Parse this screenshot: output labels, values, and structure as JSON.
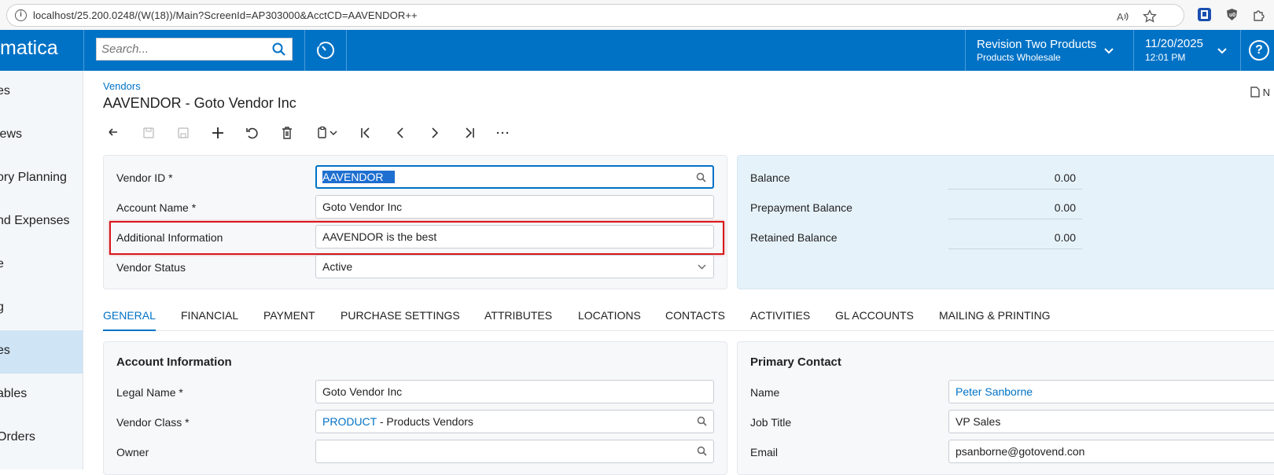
{
  "browser": {
    "url": "localhost/25.200.0248/(W(18))/Main?ScreenId=AP303000&AcctCD=AAVENDOR++"
  },
  "header": {
    "logo": "matica",
    "search_placeholder": "Search...",
    "company_title": "Revision Two Products",
    "company_sub": "Products Wholesale",
    "date": "11/20/2025",
    "time": "12:01 PM",
    "help": "?"
  },
  "sidebar": {
    "items": [
      {
        "label": "es"
      },
      {
        "label": "iews"
      },
      {
        "label": "ory Planning"
      },
      {
        "label": "nd Expenses"
      },
      {
        "label": "e"
      },
      {
        "label": "g"
      },
      {
        "label": "es"
      },
      {
        "label": "ables"
      },
      {
        "label": "Orders"
      }
    ]
  },
  "page": {
    "breadcrumb": "Vendors",
    "title": "AAVENDOR - Goto Vendor Inc",
    "notes": "N"
  },
  "summary": {
    "vendor_id_label": "Vendor ID *",
    "vendor_id_value": "AAVENDOR",
    "account_name_label": "Account Name *",
    "account_name_value": "Goto Vendor Inc",
    "additional_info_label": "Additional Information",
    "additional_info_value": "AAVENDOR is the best",
    "vendor_status_label": "Vendor Status",
    "vendor_status_value": "Active"
  },
  "balances": {
    "balance_label": "Balance",
    "balance_value": "0.00",
    "prepayment_label": "Prepayment Balance",
    "prepayment_value": "0.00",
    "retained_label": "Retained Balance",
    "retained_value": "0.00"
  },
  "tabs": [
    "GENERAL",
    "FINANCIAL",
    "PAYMENT",
    "PURCHASE SETTINGS",
    "ATTRIBUTES",
    "LOCATIONS",
    "CONTACTS",
    "ACTIVITIES",
    "GL ACCOUNTS",
    "MAILING & PRINTING"
  ],
  "account_info": {
    "title": "Account Information",
    "legal_name_label": "Legal Name *",
    "legal_name_value": "Goto Vendor Inc",
    "vendor_class_label": "Vendor Class *",
    "vendor_class_code": "PRODUCT",
    "vendor_class_desc": " - Products Vendors",
    "owner_label": "Owner",
    "owner_value": ""
  },
  "primary_contact": {
    "title": "Primary Contact",
    "name_label": "Name",
    "name_value": "Peter Sanborne",
    "job_title_label": "Job Title",
    "job_title_value": "VP Sales",
    "email_label": "Email",
    "email_value": "psanborne@gotovend.con"
  },
  "colors": {
    "brand": "#0072c6",
    "highlight": "#d7191c"
  }
}
